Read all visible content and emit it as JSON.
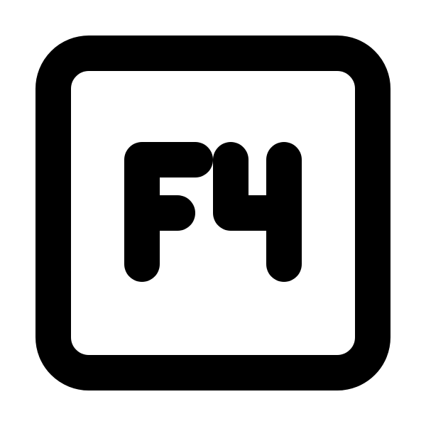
{
  "icon": {
    "name": "f4-key-icon",
    "glyph_text": "F4",
    "stroke_color": "#000000",
    "background_color": "#ffffff"
  }
}
